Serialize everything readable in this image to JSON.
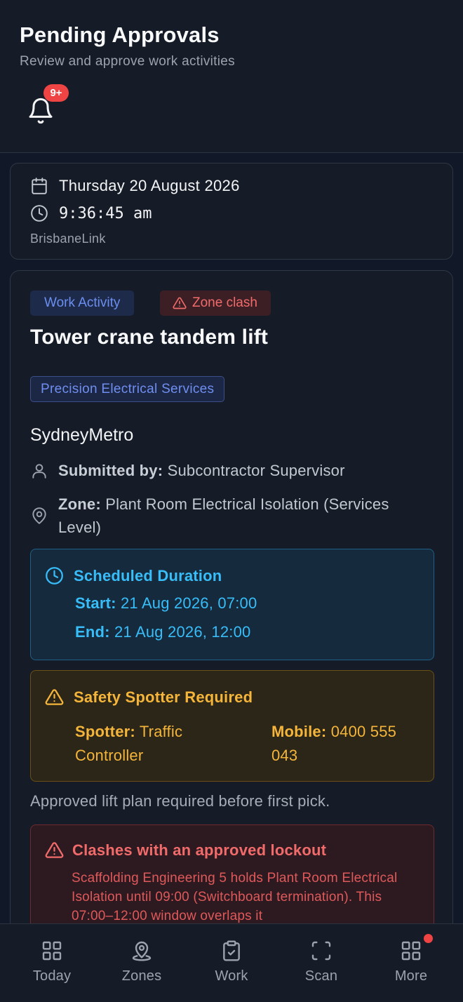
{
  "header": {
    "title": "Pending Approvals",
    "subtitle": "Review and approve work activities",
    "notifications_badge": "9+"
  },
  "datetime": {
    "date": "Thursday 20 August 2026",
    "time": "9:36:45 am",
    "project": "BrisbaneLink"
  },
  "approval": {
    "type_tag": "Work Activity",
    "clash_tag": "Zone clash",
    "title": "Tower crane tandem lift",
    "company": "Precision Electrical Services",
    "project": "SydneyMetro",
    "submitted_label": "Submitted by:",
    "submitted_value": "Subcontractor Supervisor",
    "zone_label": "Zone:",
    "zone_value": "Plant Room Electrical Isolation (Services Level)",
    "duration": {
      "heading": "Scheduled Duration",
      "start_label": "Start:",
      "start_value": "21 Aug 2026, 07:00",
      "end_label": "End:",
      "end_value": "21 Aug 2026, 12:00"
    },
    "spotter": {
      "heading": "Safety Spotter Required",
      "spotter_label": "Spotter:",
      "spotter_value": "Traffic Controller",
      "mobile_label": "Mobile:",
      "mobile_value": "0400 555 043"
    },
    "note": "Approved lift plan required before first pick.",
    "clash": {
      "heading": "Clashes with an approved lockout",
      "body": "Scaffolding Engineering 5 holds Plant Room Electrical Isolation until 09:00 (Switchboard termination). This 07:00–12:00 window overlaps it"
    }
  },
  "nav": {
    "items": [
      {
        "label": "Today",
        "icon": "grid-icon"
      },
      {
        "label": "Zones",
        "icon": "map-pin-icon"
      },
      {
        "label": "Work",
        "icon": "clipboard-check-icon"
      },
      {
        "label": "Scan",
        "icon": "scan-icon"
      },
      {
        "label": "More",
        "icon": "apps-icon"
      }
    ]
  },
  "colors": {
    "background": "#111827",
    "surface": "#161c27",
    "accent_blue": "#6b8ff0",
    "info_cyan": "#38bdf8",
    "warning_amber": "#f5b53a",
    "danger_red": "#ef4444"
  }
}
